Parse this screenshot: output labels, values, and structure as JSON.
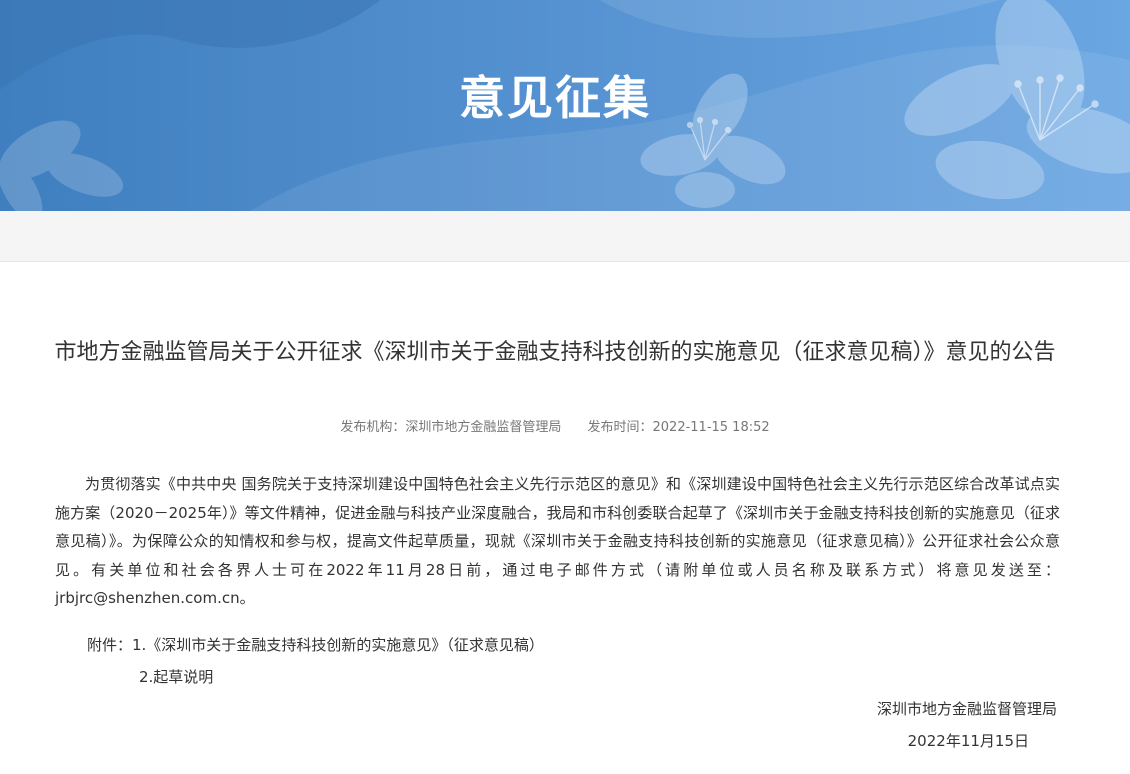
{
  "banner": {
    "title": "意见征集"
  },
  "article": {
    "title": "市地方金融监管局关于公开征求《深圳市关于金融支持科技创新的实施意见（征求意见稿）》意见的公告",
    "publisher": "发布机构：深圳市地方金融监督管理局",
    "publish_time": "发布时间：2022-11-15 18:52",
    "body": "为贯彻落实《中共中央 国务院关于支持深圳建设中国特色社会主义先行示范区的意见》和《深圳建设中国特色社会主义先行示范区综合改革试点实施方案（2020－2025年）》等文件精神，促进金融与科技产业深度融合，我局和市科创委联合起草了《深圳市关于金融支持科技创新的实施意见（征求意见稿）》。为保障公众的知情权和参与权，提高文件起草质量，现就《深圳市关于金融支持科技创新的实施意见（征求意见稿）》公开征求社会公众意见。有关单位和社会各界人士可在2022年11月28日前，通过电子邮件方式（请附单位或人员名称及联系方式）将意见发送至：jrbjrc@shenzhen.com.cn。",
    "attachment_1": "附件：1.《深圳市关于金融支持科技创新的实施意见》（征求意见稿）",
    "attachment_2": "2.起草说明",
    "signature_org": "深圳市地方金融监督管理局",
    "signature_date": "2022年11月15日"
  },
  "colors": {
    "banner_blue": "#4f8ccc",
    "text": "#333333",
    "meta": "#777777"
  }
}
